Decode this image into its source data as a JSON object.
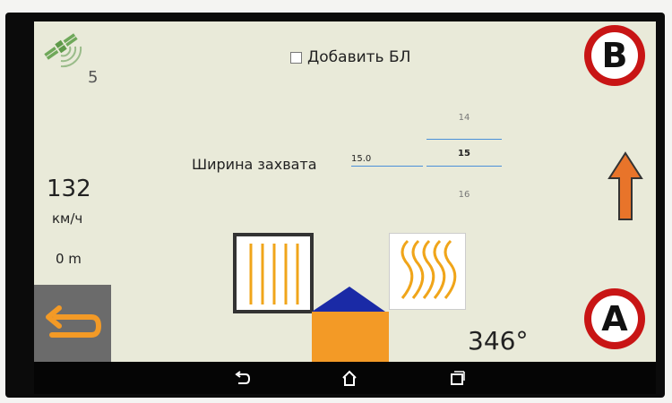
{
  "gps": {
    "satellites": "5",
    "icon": "satellite-icon"
  },
  "header": {
    "add_bl_label": "Добавить БЛ",
    "add_bl_checked": false
  },
  "width_setting": {
    "label": "Ширина захвата",
    "value": "15.0",
    "picker": {
      "above": "14",
      "selected": "15",
      "below": "16"
    }
  },
  "telemetry": {
    "speed": "132",
    "speed_unit": "км/ч",
    "distance": "0 m",
    "heading": "346°"
  },
  "buttons": {
    "b_label": "B",
    "a_label": "A"
  },
  "colors": {
    "accent_orange": "#f39a26",
    "button_red": "#c81515",
    "tractor_blue": "#1a2aa6",
    "pattern_orange": "#f0a51a"
  },
  "nav": {
    "back": "back-icon",
    "home": "home-icon",
    "recents": "recents-icon"
  }
}
